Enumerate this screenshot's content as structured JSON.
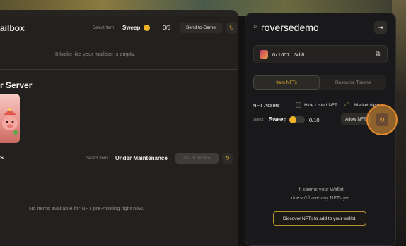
{
  "mailbox": {
    "title": "ailbox",
    "select_item_label": "Select Item",
    "select_value": "Sweep",
    "count": "0/5",
    "send_button": "Send to Game",
    "refresh_icon": "↻",
    "empty_message": "It looks like your mailbox is empty."
  },
  "server": {
    "title": "r Server"
  },
  "preminting": {
    "title": "s",
    "select_item_label": "Select Item",
    "select_value": "Under Maintenance",
    "disabled_button": "Out of Service",
    "refresh_icon": "↻",
    "empty_message": "No items available for NFT pre-minting right now."
  },
  "wallet_panel": {
    "id_prefix": "ID:",
    "username": "roversedemo",
    "logout_icon": "⇥",
    "wallet_address": "0x1607...3df8",
    "copy_icon": "⧉",
    "tabs": [
      {
        "label": "Item NFTs",
        "active": true
      },
      {
        "label": "Resource Tokens",
        "active": false
      }
    ],
    "nft_assets_label": "NFT Assets",
    "hide_listed_label": "Hide Listed NFT",
    "marketplace_label": "Marketplace",
    "select_label": "Select",
    "select_value": "Sweep",
    "count": "0/10",
    "allow_button": "Allow NFT",
    "refresh_icon": "↻",
    "empty_line1": "It seems your Wallet",
    "empty_line2": "doesn't have any NFTs yet.",
    "discover_button": "Discover NFTs to add to your wallet."
  },
  "colors": {
    "accent": "#f0b429",
    "highlight": "#e98a2c"
  }
}
